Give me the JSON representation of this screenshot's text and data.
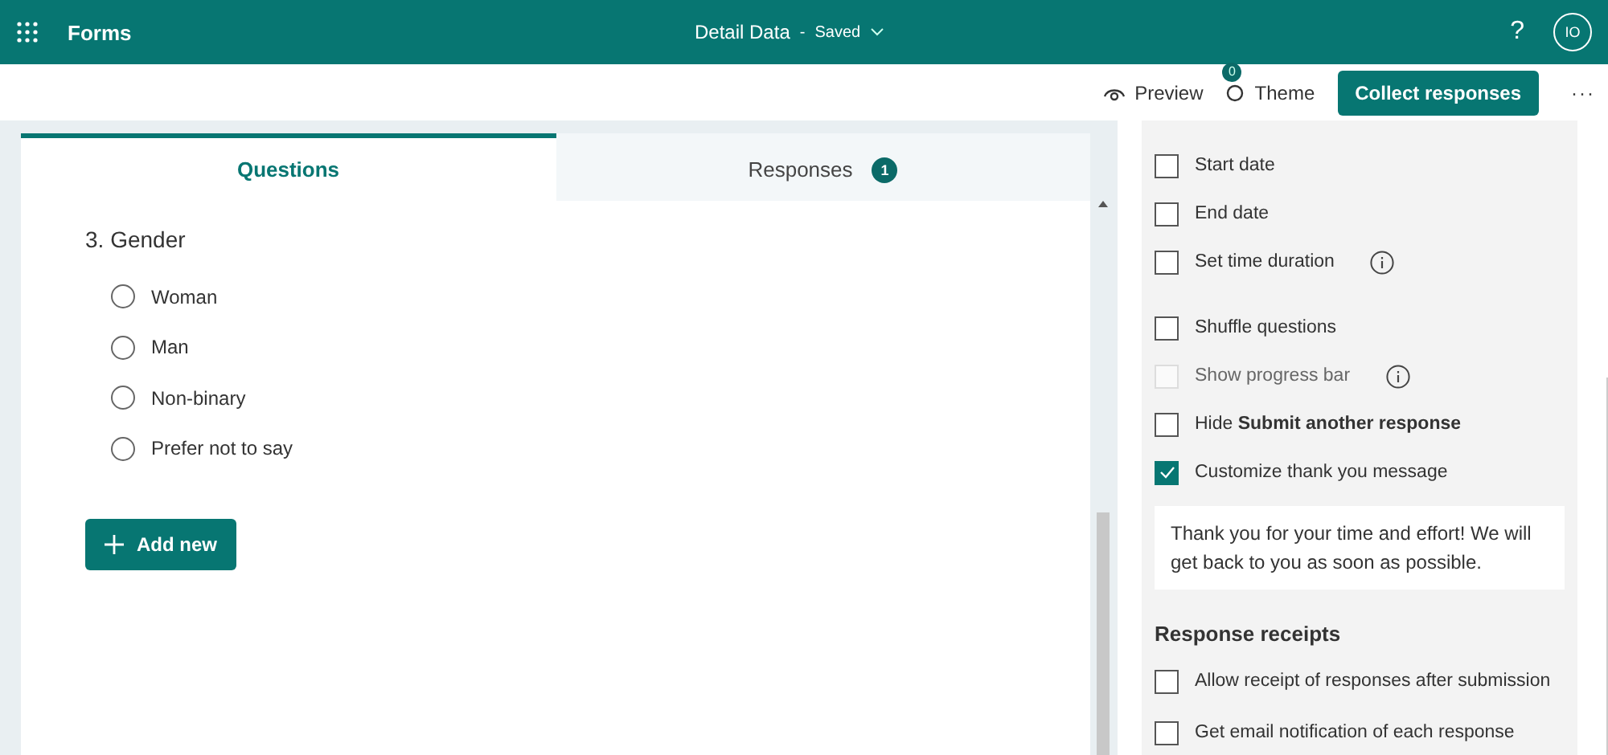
{
  "header": {
    "app_name": "Forms",
    "form_title": "Detail Data",
    "separator": "-",
    "save_state": "Saved",
    "help": "?",
    "avatar": "IO"
  },
  "toolbar": {
    "preview": "Preview",
    "theme": "Theme",
    "theme_badge": "0",
    "collect": "Collect responses",
    "more": "···"
  },
  "tabs": [
    {
      "label": "Questions",
      "selected": true
    },
    {
      "label": "Responses",
      "selected": false,
      "badge": "1"
    }
  ],
  "question": {
    "title": "3. Gender",
    "options": [
      {
        "label": "Woman",
        "selected": false
      },
      {
        "label": "Man",
        "selected": false
      },
      {
        "label": "Non-binary",
        "selected": false
      },
      {
        "label": "Prefer not to say",
        "selected": false
      }
    ]
  },
  "add_button": "Add new",
  "settings": [
    {
      "items": [
        {
          "label": "Start date",
          "checked": false,
          "disabled": false,
          "info": false
        },
        {
          "label": "End date",
          "checked": false,
          "disabled": false,
          "info": false
        },
        {
          "label": "Set time duration",
          "checked": false,
          "disabled": false,
          "info": true
        }
      ]
    },
    {
      "items": [
        {
          "label": "Shuffle questions",
          "checked": false,
          "disabled": false,
          "info": false
        },
        {
          "label": "Show progress bar",
          "checked": false,
          "disabled": true,
          "info": true
        },
        {
          "label": "Hide **Submit another response**",
          "checked": false,
          "disabled": false,
          "info": false
        },
        {
          "label": "Customize thank you message",
          "checked": true,
          "disabled": false,
          "info": false
        }
      ]
    }
  ],
  "thank_you_message": "Thank you for your time and effort! We will get back to you as soon as possible.",
  "receipts": {
    "heading": "Response receipts",
    "items": [
      {
        "label": "Allow receipt of responses after submission",
        "checked": false
      },
      {
        "label": "Get email notification of each response",
        "checked": false
      }
    ]
  }
}
